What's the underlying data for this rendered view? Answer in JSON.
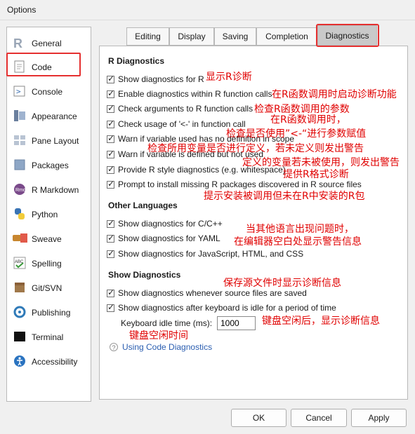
{
  "window": {
    "title": "Options"
  },
  "sidebar": {
    "items": [
      {
        "label": "General",
        "icon": "r-logo-icon"
      },
      {
        "label": "Code",
        "icon": "code-page-icon"
      },
      {
        "label": "Console",
        "icon": "console-prompt-icon"
      },
      {
        "label": "Appearance",
        "icon": "appearance-icon"
      },
      {
        "label": "Pane Layout",
        "icon": "pane-layout-icon"
      },
      {
        "label": "Packages",
        "icon": "packages-icon"
      },
      {
        "label": "R Markdown",
        "icon": "rmarkdown-icon"
      },
      {
        "label": "Python",
        "icon": "python-icon"
      },
      {
        "label": "Sweave",
        "icon": "sweave-icon"
      },
      {
        "label": "Spelling",
        "icon": "spelling-icon"
      },
      {
        "label": "Git/SVN",
        "icon": "git-icon"
      },
      {
        "label": "Publishing",
        "icon": "publishing-icon"
      },
      {
        "label": "Terminal",
        "icon": "terminal-icon"
      },
      {
        "label": "Accessibility",
        "icon": "accessibility-icon"
      }
    ],
    "selected": "Code"
  },
  "tabs": [
    {
      "label": "Editing"
    },
    {
      "label": "Display"
    },
    {
      "label": "Saving"
    },
    {
      "label": "Completion"
    },
    {
      "label": "Diagnostics"
    }
  ],
  "active_tab": "Diagnostics",
  "sections": {
    "r_diag": {
      "title": "R Diagnostics",
      "options": [
        {
          "label": "Show diagnostics for R",
          "checked": true
        },
        {
          "label": "Enable diagnostics within R function calls",
          "checked": true
        },
        {
          "label": "Check arguments to R function calls",
          "checked": true
        },
        {
          "label": "Check usage of '<-' in function call",
          "checked": true
        },
        {
          "label": "Warn if variable used has no definition in scope",
          "checked": true
        },
        {
          "label": "Warn if variable is defined but not used",
          "checked": true
        },
        {
          "label": "Provide R style diagnostics (e.g. whitespace)",
          "checked": true
        },
        {
          "label": "Prompt to install missing R packages discovered in R source files",
          "checked": true
        }
      ]
    },
    "other": {
      "title": "Other Languages",
      "options": [
        {
          "label": "Show diagnostics for C/C++",
          "checked": true
        },
        {
          "label": "Show diagnostics for YAML",
          "checked": true
        },
        {
          "label": "Show diagnostics for JavaScript, HTML, and CSS",
          "checked": true
        }
      ]
    },
    "show": {
      "title": "Show Diagnostics",
      "options": [
        {
          "label": "Show diagnostics whenever source files are saved",
          "checked": true
        },
        {
          "label": "Show diagnostics after keyboard is idle for a period of time",
          "checked": true
        }
      ],
      "idle_label": "Keyboard idle time (ms):",
      "idle_value": "1000"
    }
  },
  "help_link": "Using Code Diagnostics",
  "annotations": {
    "a1": "显示R诊断",
    "a2": "在R函数调用时启动诊断功能",
    "a3": "检查R函数调用的参数",
    "a4": "在R函数调用时，",
    "a5": "检查是否使用”<-“进行参数赋值",
    "a6": "检查所用变量是否进行定义，若未定义则发出警告",
    "a7": "定义的变量若未被使用，则发出警告",
    "a8": "提供R格式诊断",
    "a9": "提示安装被调用但未在R中安装的R包",
    "a10": "当其他语言出现问题时，",
    "a11": "在编辑器空白处显示警告信息",
    "a12": "保存源文件时显示诊断信息",
    "a13": "键盘空闲后，显示诊断信息",
    "a14": "键盘空闲时间"
  },
  "buttons": {
    "ok": "OK",
    "cancel": "Cancel",
    "apply": "Apply"
  },
  "colors": {
    "annotation": "#e00000",
    "highlight_box": "#e53030",
    "link": "#2a5db0"
  }
}
